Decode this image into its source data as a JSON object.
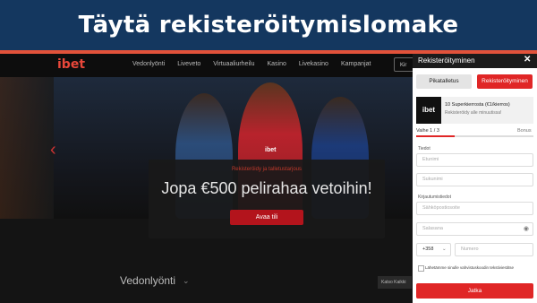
{
  "banner": {
    "title": "Täytä rekisteröitymislomake"
  },
  "colors": {
    "banner_bg": "#14375f",
    "accent": "#e2523a",
    "brand_red": "#e02626",
    "site_bg": "#141414"
  },
  "site": {
    "logo": "ibet",
    "nav": [
      "Vedonlyönti",
      "Liveveto",
      "Virtuaaliurheilu",
      "Kasino",
      "Livekasino",
      "Kampanjat"
    ],
    "login_label": "Kir",
    "hero_mark": "ibet",
    "promo": {
      "small_text": "Rekisteröidy ja talletustarjous",
      "title": "Jopa €500 pelirahaa vetoihin!",
      "button": "Avaa tili"
    },
    "section_title": "Vedonlyönti",
    "side_button": "Katso Kaikki"
  },
  "modal": {
    "title": "Rekisteröityminen",
    "close_icon": "close-icon",
    "tabs": [
      "Pikatalletus",
      "Rekisteröityminen"
    ],
    "promo": {
      "logo": "ibet",
      "line1": "10 Superkierrosta (€1/kierros)",
      "line2": "Rekisteröidy alle minuutissa!"
    },
    "step": "Vaihe 1 / 3",
    "bonus": "Bonus",
    "progress": 0.33,
    "labels": {
      "details": "Tiedot",
      "login": "Kirjautumistiedot"
    },
    "fields": {
      "first_name": "Etunimi",
      "last_name": "Sukunimi",
      "email": "Sähköpostiosoite",
      "password": "Salasana",
      "phone_prefix": "+358",
      "phone": "Numero"
    },
    "checkbox_label": "Lähetämme sinulle vahvistuskoodin tekstiviestitse",
    "continue": "Jatka"
  }
}
